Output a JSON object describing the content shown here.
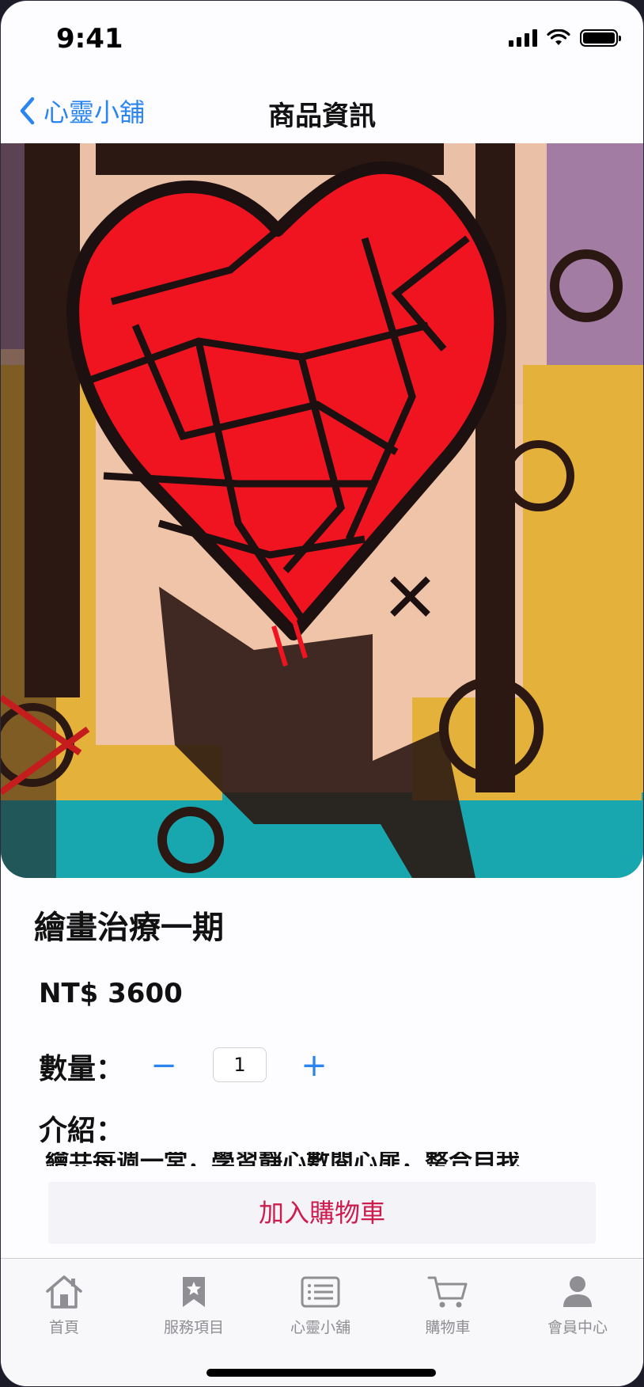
{
  "status_bar": {
    "time": "9:41"
  },
  "nav": {
    "back_label": "心靈小舖",
    "title": "商品資訊"
  },
  "product": {
    "name": "繪畫治療一期",
    "price": "NT$ 3600",
    "quantity_label": "數量：",
    "quantity": "1",
    "intro_label": "介紹：",
    "intro_partial": "繪共每週一堂，學習靜心數閱心扉，整合自我"
  },
  "actions": {
    "add_to_cart": "加入購物車",
    "minus": "−",
    "plus": "+"
  },
  "tabs": [
    {
      "label": "首頁",
      "icon": "home-icon"
    },
    {
      "label": "服務項目",
      "icon": "bookmark-star-icon"
    },
    {
      "label": "心靈小舖",
      "icon": "list-icon"
    },
    {
      "label": "購物車",
      "icon": "cart-icon"
    },
    {
      "label": "會員中心",
      "icon": "person-icon"
    }
  ],
  "colors": {
    "accent": "#2a85f0",
    "add_to_cart_text": "#cc1d4e",
    "tab_inactive": "#8e8e93"
  }
}
